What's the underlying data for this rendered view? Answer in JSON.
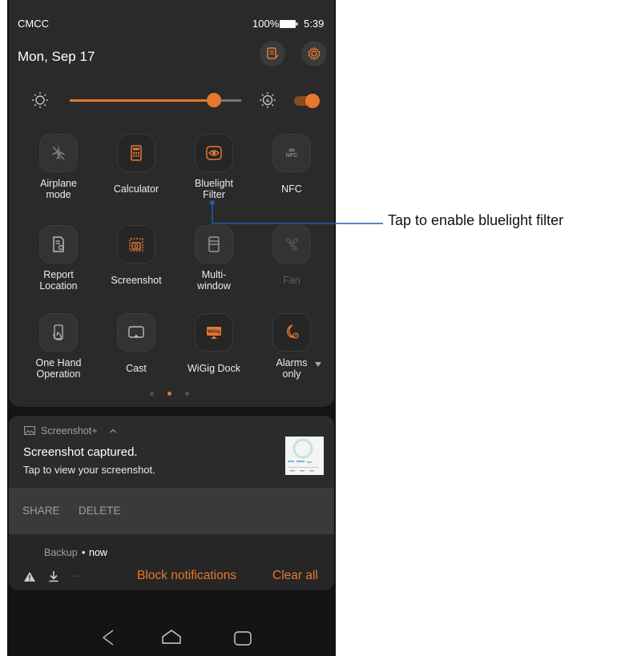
{
  "status": {
    "carrier": "CMCC",
    "battery": "100%",
    "time": "5:39"
  },
  "header": {
    "date": "Mon, Sep 17"
  },
  "brightness": {
    "level_pct": 84,
    "auto_enabled": true
  },
  "tiles": [
    {
      "label": "Airplane\nmode",
      "icon": "airplane-icon",
      "active": false
    },
    {
      "label": "Calculator",
      "icon": "calculator-icon",
      "active": true
    },
    {
      "label": "Bluelight\nFilter",
      "icon": "eye-icon",
      "active": true
    },
    {
      "label": "NFC",
      "icon": "nfc-icon",
      "active": false
    },
    {
      "label": "Report\nLocation",
      "icon": "report-location-icon",
      "active": false
    },
    {
      "label": "Screenshot",
      "icon": "screenshot-icon",
      "active": true
    },
    {
      "label": "Multi-\nwindow",
      "icon": "multi-window-icon",
      "active": false
    },
    {
      "label": "Fan",
      "icon": "fan-icon",
      "active": false,
      "disabled": true
    },
    {
      "label": "One Hand\nOperation",
      "icon": "one-hand-icon",
      "active": false
    },
    {
      "label": "Cast",
      "icon": "cast-icon",
      "active": false
    },
    {
      "label": "WiGig Dock",
      "icon": "wigig-icon",
      "active": true,
      "badge": "WiGig"
    },
    {
      "label": "Alarms\nonly",
      "icon": "alarm-moon-icon",
      "active": true
    }
  ],
  "page_indicator": {
    "count": 3,
    "current": 1
  },
  "notification": {
    "app": "Screenshot+",
    "title": "Screenshot captured.",
    "body": "Tap to view your screenshot.",
    "share": "SHARE",
    "delete": "DELETE"
  },
  "backup": {
    "app": "Backup",
    "time": "now",
    "dots": "··",
    "block": "Block notifications",
    "clear": "Clear all"
  },
  "callout": {
    "text": "Tap to enable bluelight filter"
  },
  "colors": {
    "accent": "#e8772e",
    "panel": "#2a2a2a",
    "callout_line": "#1f5fa8"
  }
}
